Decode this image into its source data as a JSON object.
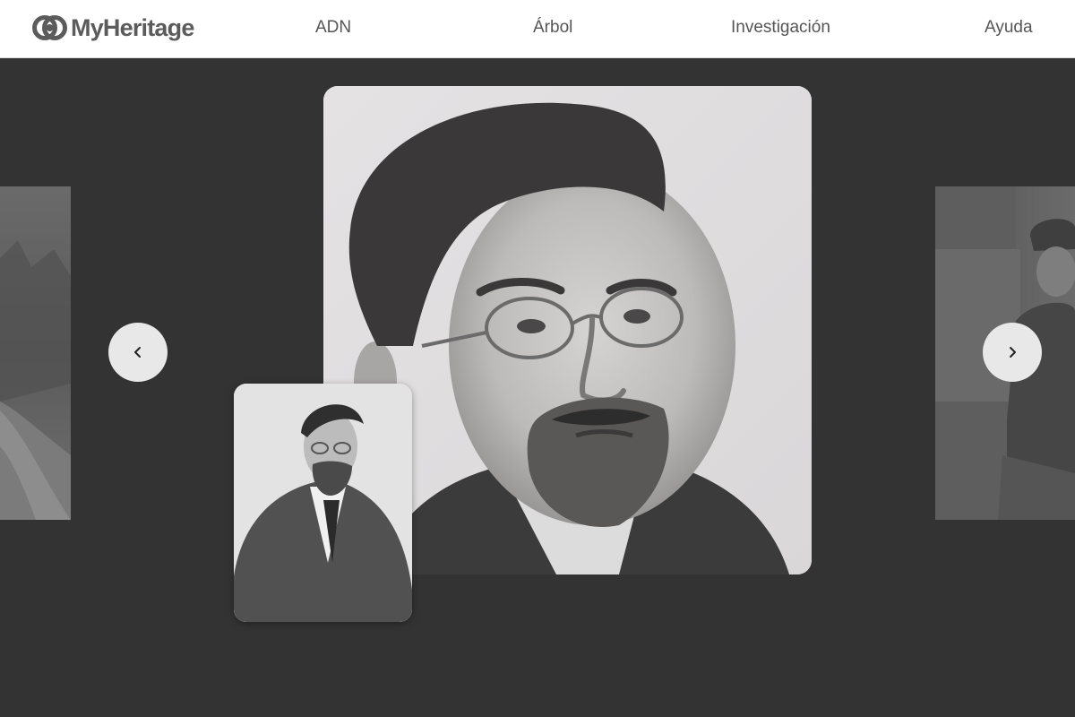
{
  "header": {
    "logo_text": "MyHeritage",
    "logo_icon": "myheritage-logo-icon",
    "nav": [
      {
        "label": "ADN"
      },
      {
        "label": "Árbol"
      },
      {
        "label": "Investigación"
      },
      {
        "label": "Ayuda"
      }
    ]
  },
  "carousel": {
    "prev_icon": "chevron-left-icon",
    "next_icon": "chevron-right-icon",
    "colors": {
      "background": "#333333",
      "button": "#e8e8e8",
      "header": "#ffffff",
      "nav_text": "#555555"
    }
  }
}
